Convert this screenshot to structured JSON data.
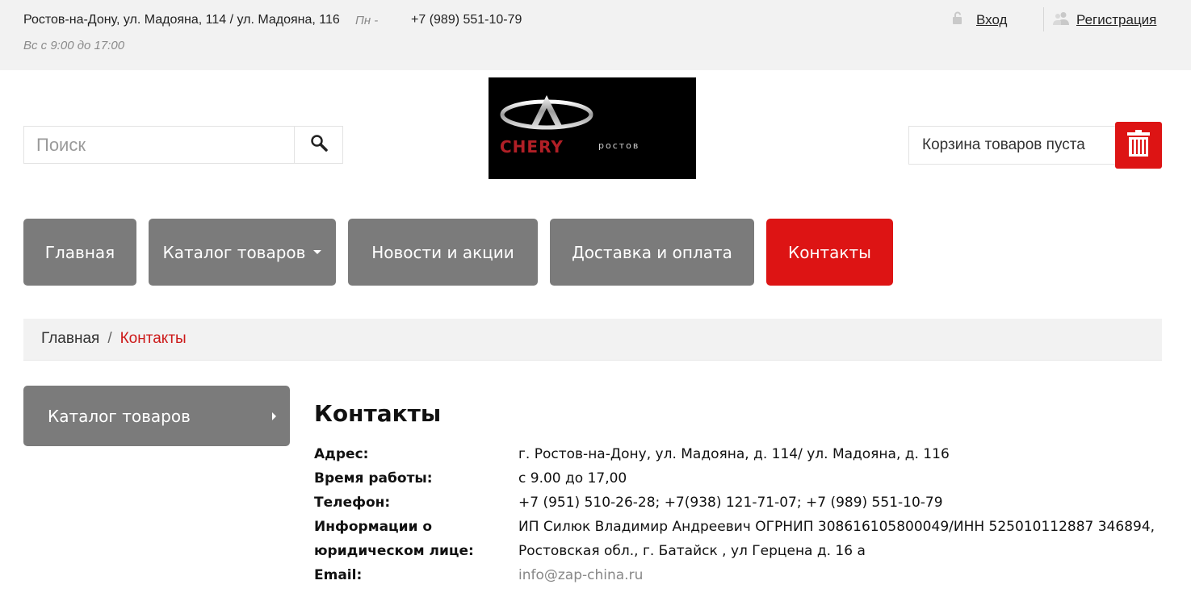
{
  "topbar": {
    "address": "Ростов-на-Дону, ул. Мадояна, 114 / ул. Мадояна, 116",
    "hours_part1": "Пн -",
    "hours_part2": "Вс с 9:00 до 17:00",
    "phone": "+7 (989) 551-10-79",
    "login_label": "Вход",
    "register_label": "Регистрация"
  },
  "search": {
    "placeholder": "Поиск"
  },
  "logo": {
    "brand": "CHERY",
    "sub": "ростов"
  },
  "cart": {
    "label": "Корзина товаров пуста"
  },
  "nav": [
    {
      "label": "Главная"
    },
    {
      "label": "Каталог товаров"
    },
    {
      "label": "Новости и акции"
    },
    {
      "label": "Доставка и оплата"
    },
    {
      "label": "Контакты"
    }
  ],
  "breadcrumb": {
    "home": "Главная",
    "separator": "/",
    "current": "Контакты"
  },
  "sidebar": {
    "catalog_label": "Каталог товаров"
  },
  "content": {
    "title": "Контакты",
    "rows": [
      {
        "label": "Адрес:",
        "value": "г. Ростов-на-Дону, ул. Мадояна, д. 114/ ул. Мадояна, д. 116"
      },
      {
        "label": "Время работы:",
        "value": "с 9.00 до 17,00"
      },
      {
        "label": "Телефон:",
        "value": "+7 (951) 510-26-28; +7(938) 121-71-07; +7 (989) 551-10-79"
      },
      {
        "label": "Информации о юридическом лице:",
        "value": "ИП Силюк Владимир Андреевич ОГРНИП 308616105800049/ИНН 525010112887 346894, Ростовская обл., г. Батайск , ул Герцена д. 16 а"
      },
      {
        "label": "Email:",
        "value": "info@zap-china.ru"
      }
    ]
  },
  "colors": {
    "accent": "#dd1414",
    "nav_bg": "#7b7b7b",
    "topbar_bg": "#f2f2f2"
  }
}
